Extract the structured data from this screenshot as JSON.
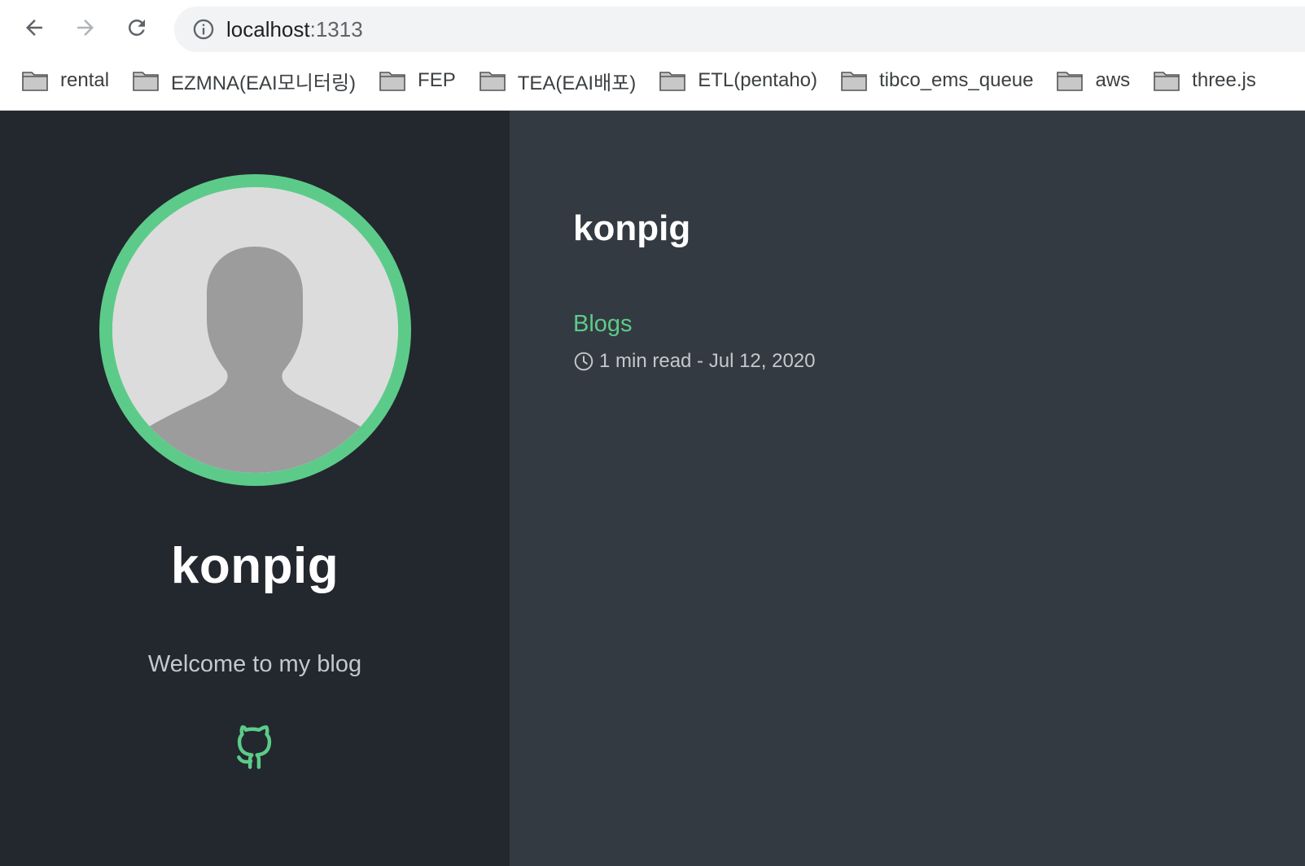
{
  "browser": {
    "url_host": "localhost",
    "url_port": ":1313",
    "icons": {
      "back": "arrow-left-icon",
      "forward": "arrow-right-icon",
      "reload": "reload-icon",
      "site_info": "info-icon"
    },
    "bookmarks": [
      {
        "label": "rental",
        "icon": "folder-icon"
      },
      {
        "label": "EZMNA(EAI모니터링)",
        "icon": "folder-icon"
      },
      {
        "label": "FEP",
        "icon": "folder-icon"
      },
      {
        "label": "TEA(EAI배포)",
        "icon": "folder-icon"
      },
      {
        "label": "ETL(pentaho)",
        "icon": "folder-icon"
      },
      {
        "label": "tibco_ems_queue",
        "icon": "folder-icon"
      },
      {
        "label": "aws",
        "icon": "folder-icon"
      },
      {
        "label": "three.js",
        "icon": "folder-icon"
      }
    ]
  },
  "sidebar": {
    "site_name": "konpig",
    "tagline": "Welcome to my blog",
    "social_icon": "github-icon"
  },
  "main": {
    "title": "konpig",
    "posts": [
      {
        "title": "Blogs",
        "meta": "1 min read - Jul 12, 2020",
        "meta_icon": "clock-icon"
      }
    ]
  },
  "colors": {
    "accent": "#5ccb89",
    "sidebar_bg": "#23272e",
    "main_bg": "#343a42"
  }
}
